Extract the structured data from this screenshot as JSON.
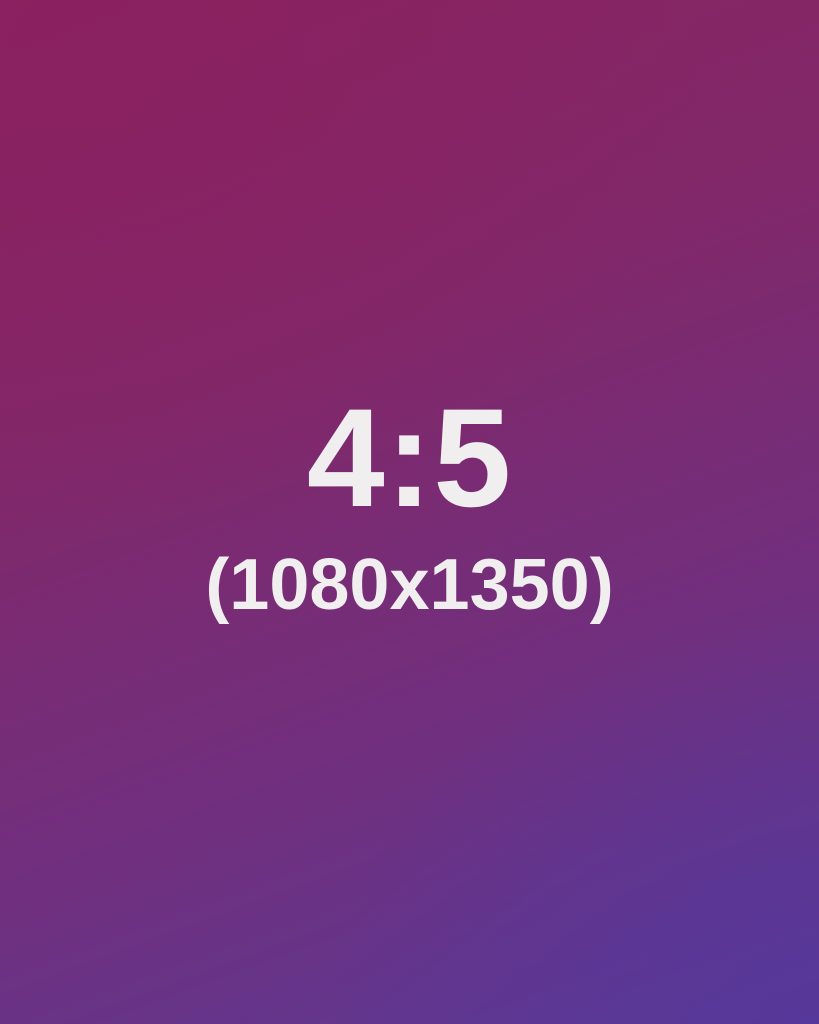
{
  "ratio_text": "4:5",
  "dimensions_text": "(1080x1350)",
  "colors": {
    "background_top": "#8a235f",
    "background_bottom": "#5a3a96",
    "text": "#f1eef0"
  }
}
